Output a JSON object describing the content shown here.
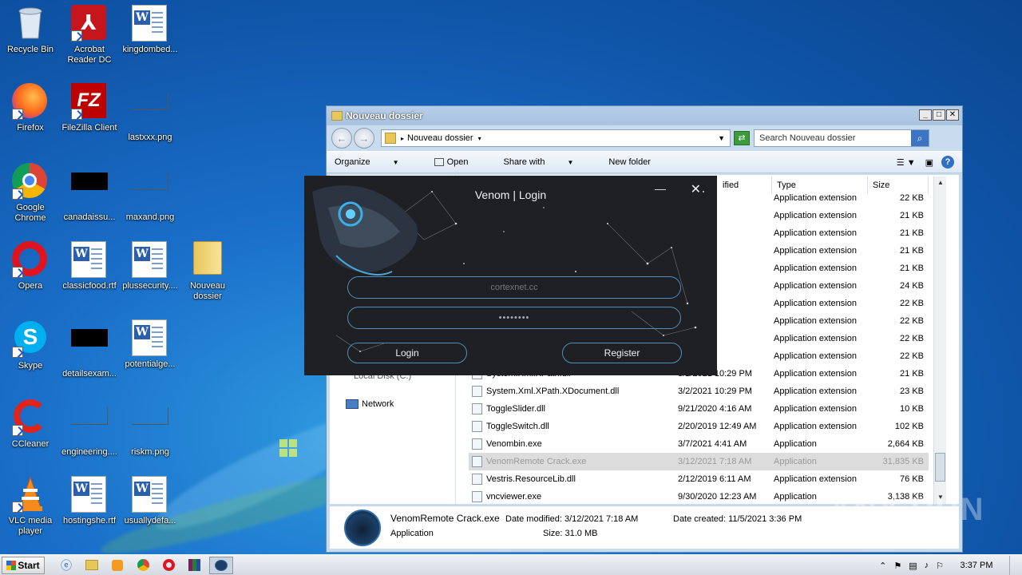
{
  "desktop": {
    "icons": [
      {
        "label": "Recycle Bin"
      },
      {
        "label": "Acrobat Reader DC"
      },
      {
        "label": "kingdombed..."
      },
      {
        "label": "Firefox"
      },
      {
        "label": "FileZilla Client"
      },
      {
        "label": "lastxxx.png"
      },
      {
        "label": "Google Chrome"
      },
      {
        "label": "canadaissu..."
      },
      {
        "label": "maxand.png"
      },
      {
        "label": "Opera"
      },
      {
        "label": "classicfood.rtf"
      },
      {
        "label": "plussecurity...."
      },
      {
        "label": "Nouveau dossier"
      },
      {
        "label": "Skype"
      },
      {
        "label": "detailsexam..."
      },
      {
        "label": "potentialge..."
      },
      {
        "label": "CCleaner"
      },
      {
        "label": "engineering...."
      },
      {
        "label": "riskm.png"
      },
      {
        "label": "VLC media player"
      },
      {
        "label": "hostingshe.rtf"
      },
      {
        "label": "usuallydefa..."
      }
    ]
  },
  "explorer": {
    "title": "Nouveau dossier",
    "address": "Nouveau dossier",
    "search_placeholder": "Search Nouveau dossier",
    "toolbar": {
      "organize": "Organize",
      "open": "Open",
      "share_with": "Share with",
      "new_folder": "New folder"
    },
    "columns": {
      "date": "ified",
      "type": "Type",
      "size": "Size"
    },
    "nav": {
      "network": "Network",
      "local_disk": "Local Disk (C:)"
    },
    "rows": [
      {
        "name": "",
        "date": "10:29 PM",
        "type": "Application extension",
        "size": "22 KB"
      },
      {
        "name": "",
        "date": "10:29 PM",
        "type": "Application extension",
        "size": "21 KB"
      },
      {
        "name": "",
        "date": "10:29 PM",
        "type": "Application extension",
        "size": "21 KB"
      },
      {
        "name": "",
        "date": "10:29 PM",
        "type": "Application extension",
        "size": "21 KB"
      },
      {
        "name": "",
        "date": "10:29 PM",
        "type": "Application extension",
        "size": "21 KB"
      },
      {
        "name": "",
        "date": "10:29 PM",
        "type": "Application extension",
        "size": "24 KB"
      },
      {
        "name": "",
        "date": "10:29 PM",
        "type": "Application extension",
        "size": "22 KB"
      },
      {
        "name": "",
        "date": "10:29 PM",
        "type": "Application extension",
        "size": "22 KB"
      },
      {
        "name": "",
        "date": "10:29 PM",
        "type": "Application extension",
        "size": "22 KB"
      },
      {
        "name": "",
        "date": "10:29 PM",
        "type": "Application extension",
        "size": "22 KB"
      },
      {
        "name": "System.Xml.XPath.dll",
        "date": "3/2/2021 10:29 PM",
        "type": "Application extension",
        "size": "21 KB"
      },
      {
        "name": "System.Xml.XPath.XDocument.dll",
        "date": "3/2/2021 10:29 PM",
        "type": "Application extension",
        "size": "23 KB"
      },
      {
        "name": "ToggleSlider.dll",
        "date": "9/21/2020 4:16 AM",
        "type": "Application extension",
        "size": "10 KB"
      },
      {
        "name": "ToggleSwitch.dll",
        "date": "2/20/2019 12:49 AM",
        "type": "Application extension",
        "size": "102 KB"
      },
      {
        "name": "Venombin.exe",
        "date": "3/7/2021 4:41 AM",
        "type": "Application",
        "size": "2,664 KB"
      },
      {
        "name": "VenomRemote Crack.exe",
        "date": "3/12/2021 7:18 AM",
        "type": "Application",
        "size": "31,835 KB"
      },
      {
        "name": "Vestris.ResourceLib.dll",
        "date": "2/12/2019 6:11 AM",
        "type": "Application extension",
        "size": "76 KB"
      },
      {
        "name": "vncviewer.exe",
        "date": "9/30/2020 12:23 AM",
        "type": "Application",
        "size": "3,138 KB"
      }
    ],
    "details": {
      "filename": "VenomRemote Crack.exe",
      "type": "Application",
      "date_modified": "Date modified: 3/12/2021 7:18 AM",
      "date_created": "Date created: 11/5/2021 3:36 PM",
      "size": "Size: 31.0 MB"
    }
  },
  "venom": {
    "title": "Venom | Login",
    "username_value": "cortexnet.cc",
    "password_value": "••••••••",
    "login_label": "Login",
    "register_label": "Register",
    "accent": "#4c8fba"
  },
  "taskbar": {
    "start": "Start",
    "clock": "3:37 PM"
  },
  "watermark": "ANY RUN"
}
